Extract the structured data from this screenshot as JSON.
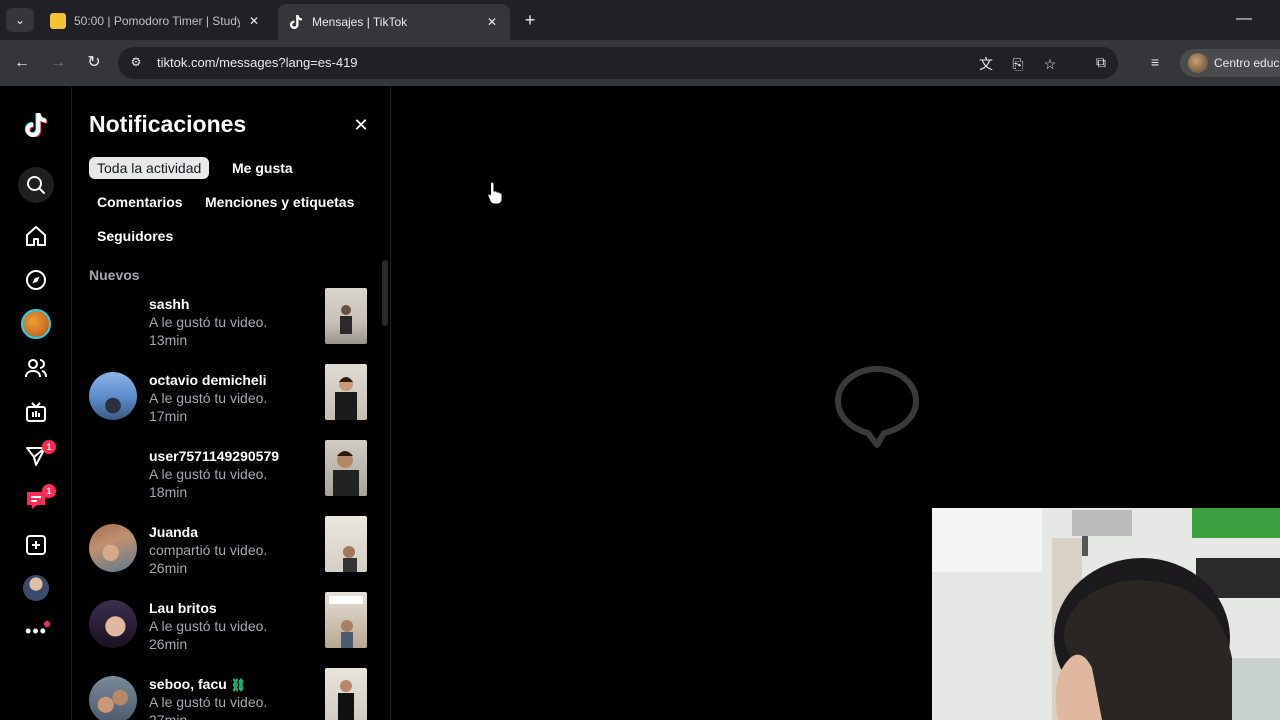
{
  "browser": {
    "tabs": [
      {
        "title": "50:00 | Pomodoro Timer | Study",
        "favicon": "pomodoro-icon",
        "active": false
      },
      {
        "title": "Mensajes | TikTok",
        "favicon": "tiktok-icon",
        "active": true
      }
    ],
    "url": "tiktok.com/messages?lang=es-419",
    "profile_label": "Centro educ"
  },
  "rail": {
    "items": [
      {
        "name": "tiktok-logo",
        "icon": "tiktok-icon"
      },
      {
        "name": "search",
        "icon": "search-icon"
      },
      {
        "name": "home",
        "icon": "home-icon"
      },
      {
        "name": "explore",
        "icon": "compass-icon"
      },
      {
        "name": "live-avatar",
        "icon": "avatar"
      },
      {
        "name": "following",
        "icon": "users-icon"
      },
      {
        "name": "live",
        "icon": "tv-icon"
      },
      {
        "name": "activity",
        "icon": "inbox-icon",
        "badge": "1"
      },
      {
        "name": "messages",
        "icon": "message-icon",
        "badge": "1"
      },
      {
        "name": "upload",
        "icon": "plus-square-icon"
      },
      {
        "name": "profile",
        "icon": "avatar"
      },
      {
        "name": "more",
        "icon": "more-icon"
      }
    ]
  },
  "panel": {
    "title": "Notificaciones",
    "filters": [
      "Toda la actividad",
      "Me gusta",
      "Comentarios",
      "Menciones y etiquetas",
      "Seguidores"
    ],
    "active_filter": "Toda la actividad",
    "section": "Nuevos",
    "notifications": [
      {
        "name": "sashh",
        "action": "A le gustó tu video.",
        "time": "13min"
      },
      {
        "name": "octavio demicheli",
        "action": "A le gustó tu video.",
        "time": "17min"
      },
      {
        "name": "user7571149290579",
        "action": "A le gustó tu video.",
        "time": "18min"
      },
      {
        "name": "Juanda",
        "action": "compartió tu video.",
        "time": "26min"
      },
      {
        "name": "Lau britos",
        "action": "A le gustó tu video.",
        "time": "26min"
      },
      {
        "name": "seboo, facu",
        "action": "A le gustó tu video.",
        "time": "27min"
      }
    ]
  },
  "colors": {
    "accent": "#fe2c55",
    "background": "#000000",
    "secondary_text": "#a7a7ab"
  }
}
